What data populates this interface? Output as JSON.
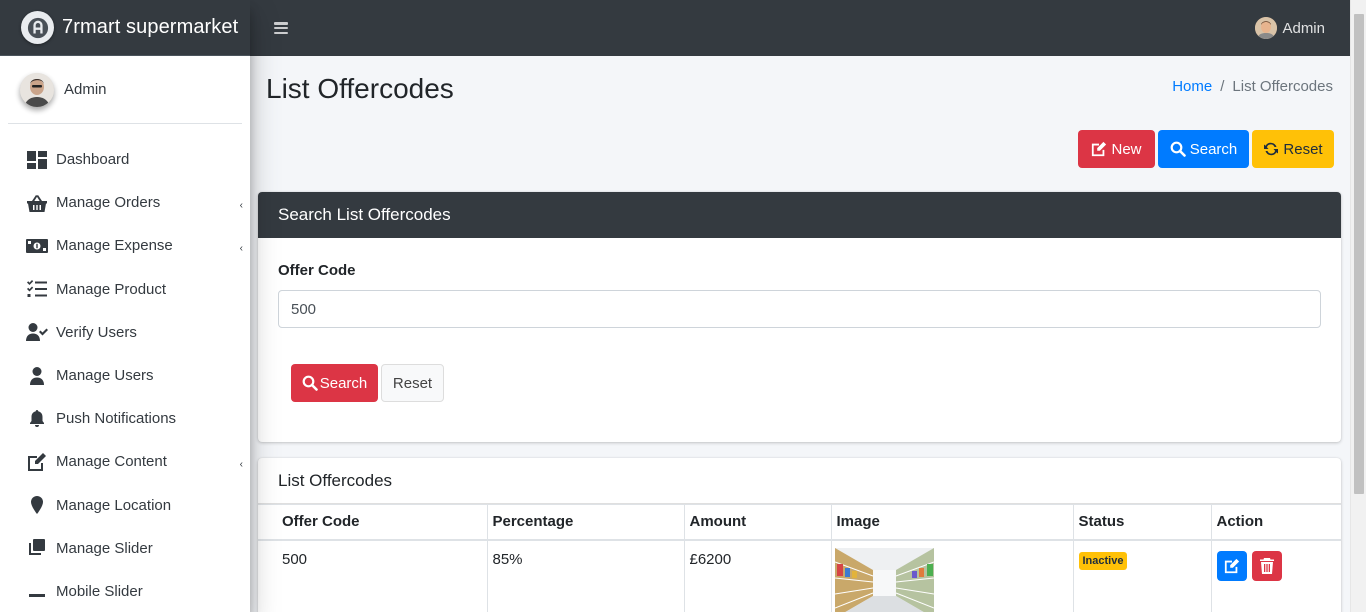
{
  "brand": {
    "name": "7rmart supermarket"
  },
  "sidebar": {
    "user_name": "Admin",
    "items": [
      {
        "label": "Dashboard",
        "icon": "dashboard-icon",
        "has_caret": false
      },
      {
        "label": "Manage Orders",
        "icon": "basket-icon",
        "has_caret": true
      },
      {
        "label": "Manage Expense",
        "icon": "money-icon",
        "has_caret": true
      },
      {
        "label": "Manage Product",
        "icon": "tasks-icon",
        "has_caret": false
      },
      {
        "label": "Verify Users",
        "icon": "user-check-icon",
        "has_caret": false
      },
      {
        "label": "Manage Users",
        "icon": "user-icon",
        "has_caret": false
      },
      {
        "label": "Push Notifications",
        "icon": "bell-icon",
        "has_caret": false
      },
      {
        "label": "Manage Content",
        "icon": "edit-icon",
        "has_caret": true
      },
      {
        "label": "Manage Location",
        "icon": "map-marker-icon",
        "has_caret": false
      },
      {
        "label": "Manage Slider",
        "icon": "clone-icon",
        "has_caret": false
      },
      {
        "label": "Mobile Slider",
        "icon": "minus-icon",
        "has_caret": false
      }
    ]
  },
  "topbar": {
    "user_name": "Admin"
  },
  "page": {
    "title": "List Offercodes",
    "breadcrumb": {
      "home": "Home",
      "separator": "/",
      "current": "List Offercodes"
    }
  },
  "actions": {
    "new_label": "New",
    "search_label": "Search",
    "reset_label": "Reset"
  },
  "search_card": {
    "header": "Search List Offercodes",
    "field_label": "Offer Code",
    "field_value": "500",
    "search_label": "Search",
    "reset_label": "Reset"
  },
  "list_card": {
    "title": "List Offercodes",
    "columns": [
      "Offer Code",
      "Percentage",
      "Amount",
      "Image",
      "Status",
      "Action"
    ],
    "rows": [
      {
        "offer_code": "500",
        "percentage": "85%",
        "amount": "£6200",
        "image": "supermarket-aisle-image",
        "status": "Inactive"
      }
    ]
  },
  "colors": {
    "danger": "#dc3545",
    "primary": "#007bff",
    "warning": "#ffc107",
    "dark": "#343a40"
  }
}
